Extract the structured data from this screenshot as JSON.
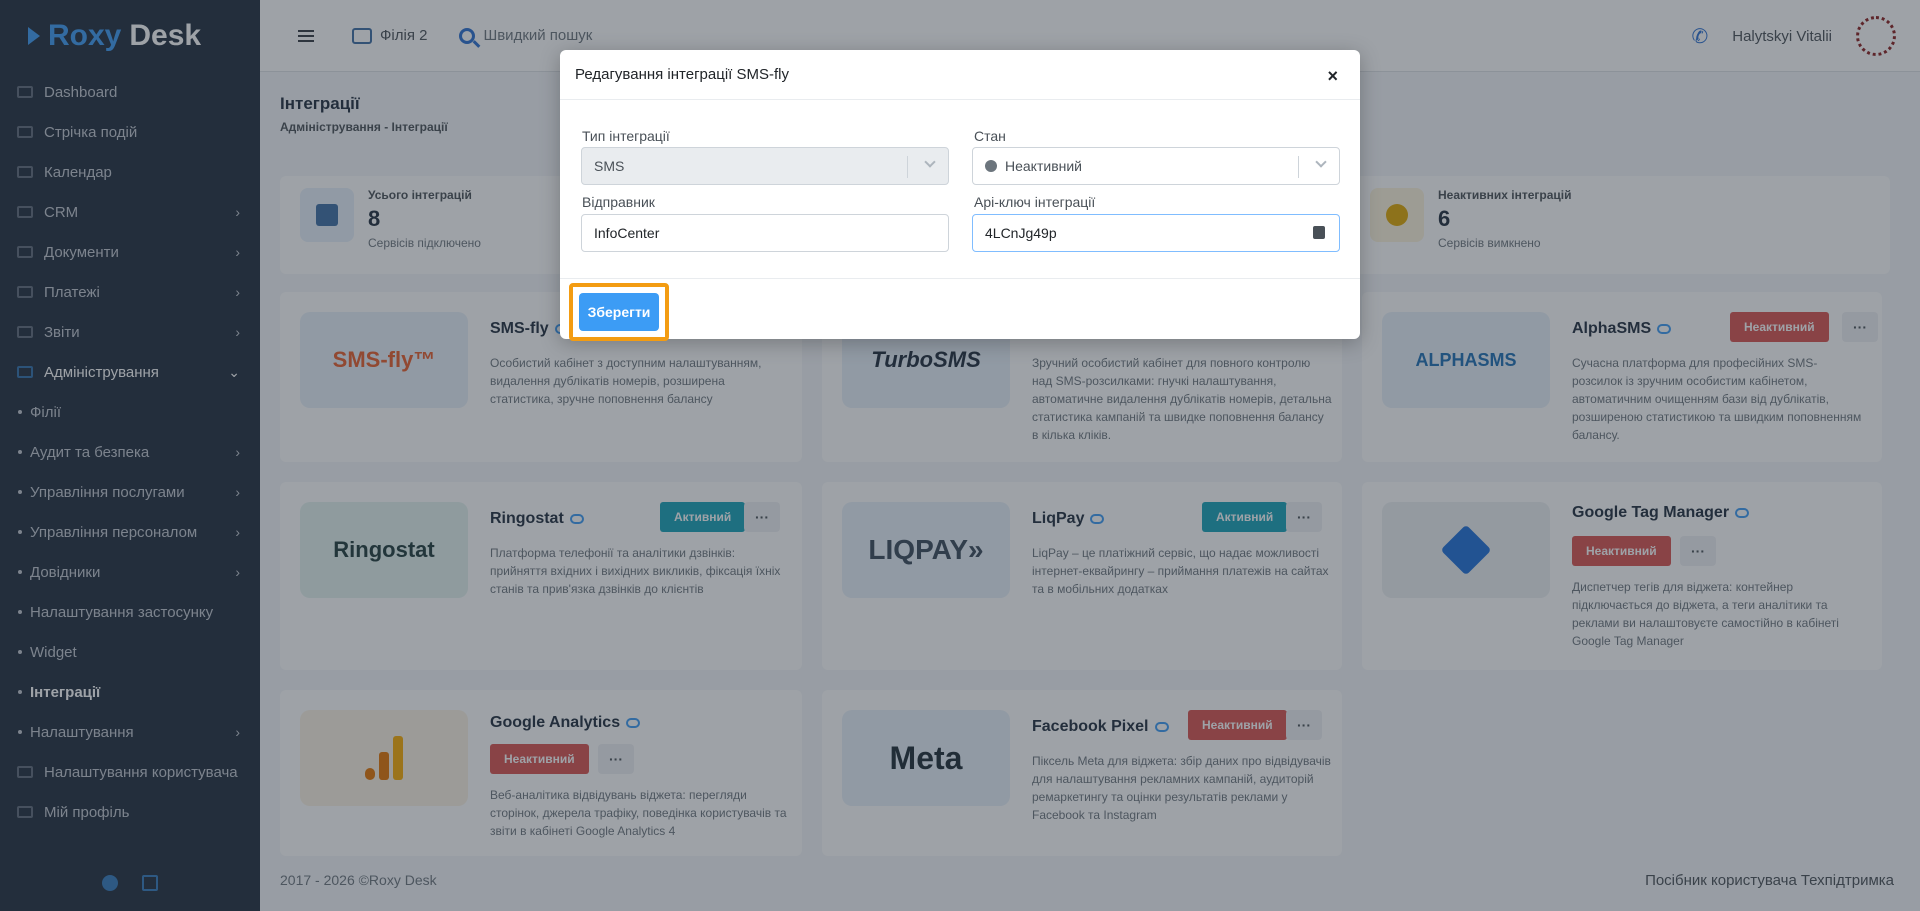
{
  "app": {
    "logo_part1": "Roxy",
    "logo_part2": "Desk"
  },
  "sidebar": {
    "items": [
      {
        "label": "Dashboard"
      },
      {
        "label": "Стрічка подій"
      },
      {
        "label": "Календар"
      },
      {
        "label": "CRM"
      },
      {
        "label": "Документи"
      },
      {
        "label": "Платежі"
      },
      {
        "label": "Звіти"
      },
      {
        "label": "Адміністрування"
      },
      {
        "label": "Філії"
      },
      {
        "label": "Аудит та безпека"
      },
      {
        "label": "Управління послугами"
      },
      {
        "label": "Управління персоналом"
      },
      {
        "label": "Довідники"
      },
      {
        "label": "Налаштування застосунку"
      },
      {
        "label": "Widget"
      },
      {
        "label": "Інтеграції"
      },
      {
        "label": "Налаштування"
      },
      {
        "label": "Налаштування користувача"
      },
      {
        "label": "Мій профіль"
      }
    ]
  },
  "header": {
    "branch": "Філія 2",
    "search_placeholder": "Швидкий пошук",
    "user_name": "Halytskyi Vitalii"
  },
  "page": {
    "title": "Інтеграції",
    "breadcrumb": "Адміністрування - Інтеграції"
  },
  "stats": {
    "total_label": "Усього інтеграцій",
    "total_value": "8",
    "total_sub": "Сервісів підключено",
    "inactive_label": "Неактивних інтеграцій",
    "inactive_value": "6",
    "inactive_sub": "Сервісів вимкнено"
  },
  "cards": [
    {
      "title": "SMS-fly",
      "logo": "SMS-fly™",
      "status": "",
      "desc": "Особистий кабінет з доступним налаштуванням, видалення дублікатів номерів, розширена статистика, зручне поповнення балансу"
    },
    {
      "title": "",
      "logo": "TurboSMS",
      "status": "",
      "desc": "Зручний особистий кабінет для повного контролю над SMS-розсилками: гнучкі налаштування, автоматичне видалення дублікатів номерів, детальна статистика кампаній та швидке поповнення балансу в кілька кліків."
    },
    {
      "title": "AlphaSMS",
      "logo": "ALPHASMS",
      "status": "Неактивний",
      "desc": "Сучасна платформа для професійних SMS-розсилок із зручним особистим кабінетом, автоматичним очищенням бази від дублікатів, розширеною статистикою та швидким поповненням балансу."
    },
    {
      "title": "Ringostat",
      "logo": "Ringostat",
      "status": "Активний",
      "desc": "Платформа телефонії та аналітики дзвінків: прийняття вхідних і вихідних викликів, фіксація їхніх станів та прив'язка дзвінків до клієнтів"
    },
    {
      "title": "LiqPay",
      "logo": "LIQPAY»",
      "status": "Активний",
      "desc": "LiqPay – це платіжний сервіс, що надає можливості інтернет-еквайрингу – приймання платежів на сайтах та в мобільних додатках"
    },
    {
      "title": "Google Tag Manager",
      "logo": "",
      "status": "Неактивний",
      "desc": "Диспетчер тегів для віджета: контейнер підключається до віджета, а теги аналітики та реклами ви налаштовуєте самостійно в кабінеті Google Tag Manager"
    },
    {
      "title": "Google Analytics",
      "logo": "",
      "status": "Неактивний",
      "desc": "Веб-аналітика відвідувань віджета: перегляди сторінок, джерела трафіку, поведінка користувачів та звіти в кабінеті Google Analytics 4"
    },
    {
      "title": "Facebook Pixel",
      "logo": "Meta",
      "status": "Неактивний",
      "desc": "Піксель Meta для віджета: збір даних про відвідувачів для налаштування рекламних кампаній, аудиторій ремаркетингу та оцінки результатів реклами у Facebook та Instagram"
    }
  ],
  "more_label": "···",
  "footer": {
    "copyright": "2017 - 2026 ©Roxy Desk",
    "guide": "Посібник користувача",
    "support": "Техпідтримка"
  },
  "modal": {
    "title": "Редагування інтеграції SMS-fly",
    "close": "×",
    "type_label": "Тип інтеграції",
    "type_value": "SMS",
    "state_label": "Стан",
    "state_value": "Неактивний",
    "sender_label": "Відправник",
    "sender_value": "InfoCenter",
    "apikey_label": "Api-ключ інтеграції",
    "apikey_value": "4LCnJg49p",
    "save_label": "Зберегти"
  },
  "colors": {
    "accent": "#3c9cf5",
    "highlight": "#f39c12",
    "inactive": "#d9534f",
    "active": "#17a2b8"
  }
}
